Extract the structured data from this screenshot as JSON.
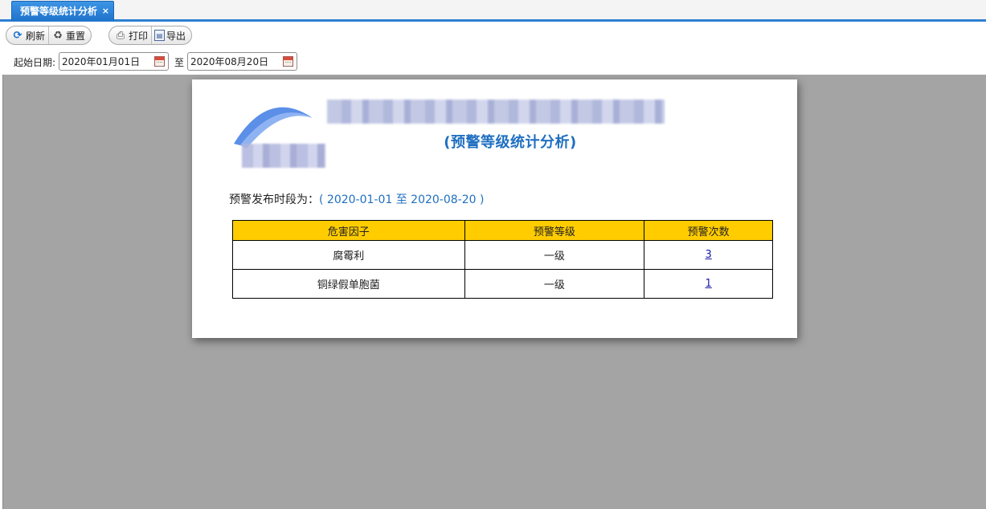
{
  "tab": {
    "title": "预警等级统计分析",
    "close": "×"
  },
  "toolbar": {
    "refresh_label": "刷新",
    "reset_label": "重置",
    "print_label": "打印",
    "export_label": "导出"
  },
  "filter": {
    "start_label": "起始日期:",
    "start_value": "2020年01月01日",
    "to_label": "至",
    "end_value": "2020年08月20日"
  },
  "report": {
    "subtitle": "(预警等级统计分析)",
    "period_label": "预警发布时段为：",
    "period_range": "( 2020-01-01 至 2020-08-20 )",
    "columns": [
      "危害因子",
      "预警等级",
      "预警次数"
    ],
    "rows": [
      {
        "factor": "腐霉利",
        "level": "一级",
        "count": "3"
      },
      {
        "factor": "铜绿假单胞菌",
        "level": "一级",
        "count": "1"
      }
    ]
  },
  "colors": {
    "tab_blue": "#2e7fd2",
    "title_blue": "#1f6fc1",
    "header_yellow": "#ffcc00",
    "viewer_gray": "#a4a4a4"
  }
}
